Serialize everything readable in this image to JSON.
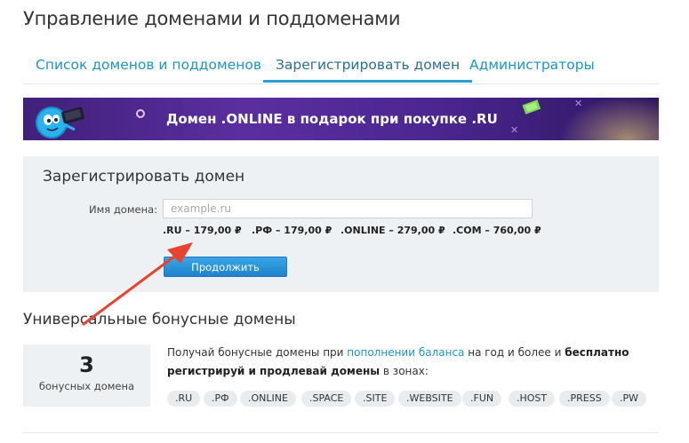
{
  "page": {
    "title": "Управление доменами и поддоменами"
  },
  "tabs": [
    {
      "label": "Список доменов и поддоменов",
      "active": false
    },
    {
      "label": "Зарегистрировать домен",
      "active": true
    },
    {
      "label": "Администраторы",
      "active": false
    }
  ],
  "banner": {
    "text": "Домен .ONLINE в подарок при покупке .RU",
    "colors": {
      "start": "#40217a",
      "end": "#2e1660",
      "text": "#ffffff"
    }
  },
  "register": {
    "title": "Зарегистрировать домен",
    "field_label": "Имя домена:",
    "placeholder": "example.ru",
    "value": "",
    "prices": [
      ".RU – 179,00 ₽",
      ".РФ – 179,00 ₽",
      ".ONLINE – 279,00 ₽",
      ".COM – 760,00 ₽"
    ],
    "button_label": "Продолжить"
  },
  "bonus": {
    "title": "Универсальные бонусные домены",
    "count": "3",
    "count_label": "бонусных домена",
    "desc_part1": "Получай бонусные домены при ",
    "desc_link": "пополнении баланса",
    "desc_part2": " на год и более и ",
    "desc_bold": "бесплатно регистрируй и продлевай домены",
    "desc_part3": " в зонах:",
    "zones": [
      ".RU",
      ".РФ",
      ".ONLINE",
      ".SPACE",
      ".SITE",
      ".WEBSITE",
      ".FUN",
      ".HOST",
      ".PRESS",
      ".PW"
    ]
  },
  "colors": {
    "accent": "#1c95c8",
    "active_tab_underline": "#2a9fd6",
    "button": "#2a8fd8",
    "panel_bg": "#eef1f3",
    "annotation_arrow": "#e8432e"
  },
  "icons": {
    "banner_mascot": "mascot-icon",
    "annotation": "arrow-annotation-icon"
  }
}
